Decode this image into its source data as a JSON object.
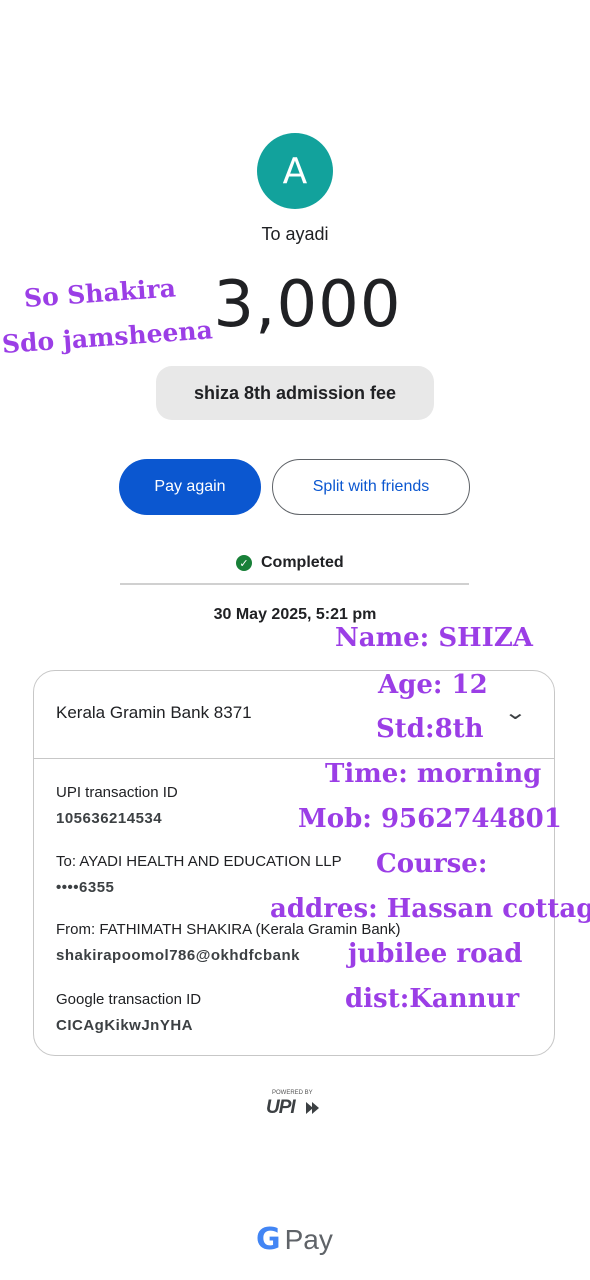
{
  "payee": {
    "avatar_letter": "A",
    "to_label": "To ayadi"
  },
  "amount": "3,000",
  "note": "shiza 8th admission fee",
  "actions": {
    "pay_again": "Pay again",
    "split": "Split with friends"
  },
  "status": {
    "icon": "check-circle-icon",
    "text": "Completed",
    "color": "#188038"
  },
  "datetime": "30 May 2025, 5:21 pm",
  "details": {
    "bank": "Kerala Gramin Bank 8371",
    "upi_label": "UPI transaction ID",
    "upi_value": "105636214534",
    "to_label": "To: AYADI HEALTH AND EDUCATION LLP",
    "to_value": "••••6355",
    "from_label": "From: FATHIMATH SHAKIRA (Kerala Gramin Bank)",
    "from_value": "shakirapoomol786@okhdfcbank",
    "google_label": "Google transaction ID",
    "google_value": "CICAgKikwJnYHA"
  },
  "upi_logo": {
    "powered_by": "POWERED BY",
    "text": "UPI"
  },
  "footer": {
    "g": "G",
    "pay": "Pay"
  },
  "handwritten": {
    "line1": "So Shakira",
    "line2": "Sdo jamsheena",
    "name": "Name: SHIZA",
    "age": "Age: 12",
    "std": "Std:8th",
    "time": "Time: morning",
    "mob": "Mob: 9562744801",
    "course": "Course:",
    "address": "addres: Hassan cottage",
    "road": "jubilee road",
    "dist": "dist:Kannur"
  },
  "colors": {
    "accent": "#0b57d0",
    "avatar": "#12a29c",
    "handwritten": "#9b3ee6"
  }
}
